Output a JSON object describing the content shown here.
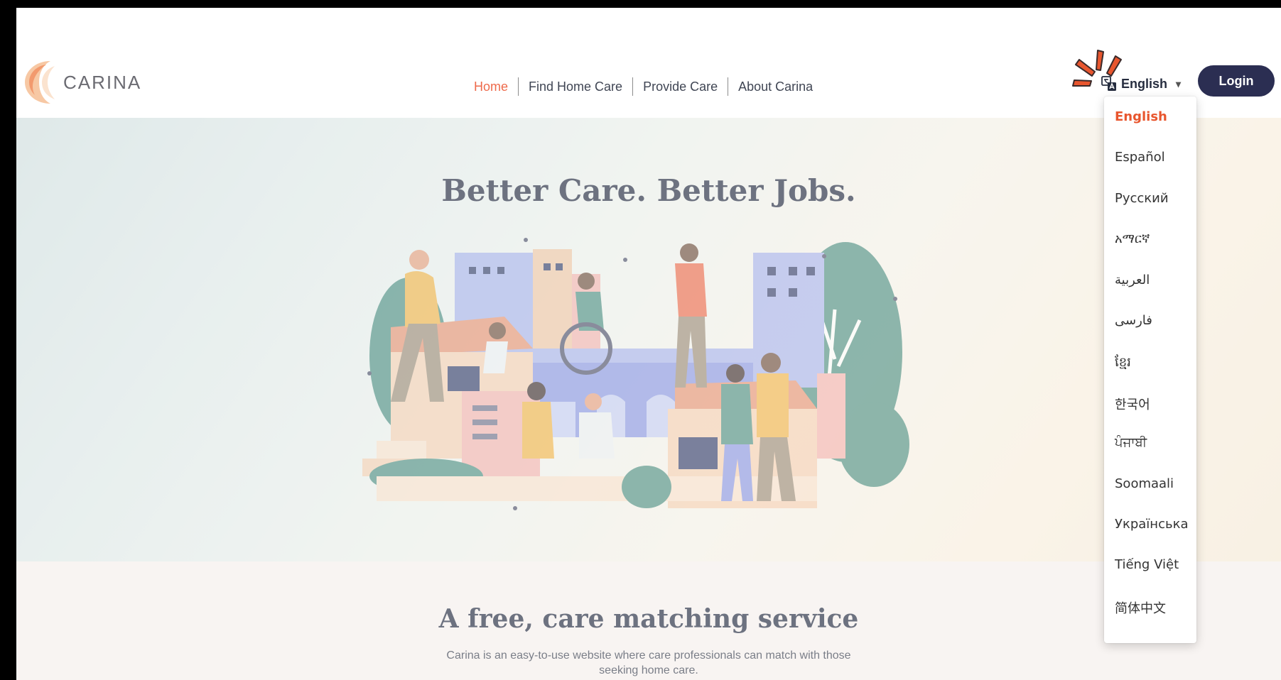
{
  "brand": {
    "name": "CARINA"
  },
  "nav": {
    "items": [
      {
        "label": "Home",
        "active": true
      },
      {
        "label": "Find Home Care",
        "active": false
      },
      {
        "label": "Provide Care",
        "active": false
      },
      {
        "label": "About Carina",
        "active": false
      }
    ]
  },
  "language": {
    "current": "English",
    "icon": "translate-icon",
    "options": [
      "English",
      "Español",
      "Русский",
      "አማርኛ",
      "العربية",
      "فارسی",
      "ខ្មែរ",
      "한국어",
      "ਪੰਜਾਬੀ",
      "Soomaali",
      "Українська",
      "Tiếng Việt",
      "简体中文"
    ]
  },
  "login": {
    "label": "Login"
  },
  "hero": {
    "title": "Better Care. Better Jobs."
  },
  "section2": {
    "title": "A free, care matching service",
    "description": "Carina is an easy-to-use website where care professionals can match with those seeking home care."
  },
  "colors": {
    "accent": "#ee6a4b",
    "login_bg": "#2b2e52",
    "text_dark": "#262d3f"
  }
}
